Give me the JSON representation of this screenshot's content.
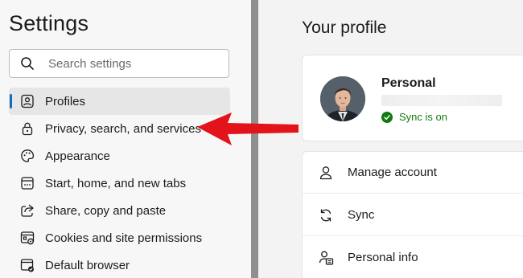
{
  "sidebar": {
    "title": "Settings",
    "search": {
      "placeholder": "Search settings",
      "icon": "search-icon"
    },
    "items": [
      {
        "label": "Profiles",
        "icon": "profile-icon",
        "active": true
      },
      {
        "label": "Privacy, search, and services",
        "icon": "lock-icon",
        "active": false
      },
      {
        "label": "Appearance",
        "icon": "palette-icon",
        "active": false
      },
      {
        "label": "Start, home, and new tabs",
        "icon": "tabs-icon",
        "active": false
      },
      {
        "label": "Share, copy and paste",
        "icon": "share-icon",
        "active": false
      },
      {
        "label": "Cookies and site permissions",
        "icon": "cookies-icon",
        "active": false
      },
      {
        "label": "Default browser",
        "icon": "default-browser-icon",
        "active": false
      }
    ]
  },
  "main": {
    "heading": "Your profile",
    "profile": {
      "name": "Personal",
      "sync_status": "Sync is on"
    },
    "menu": [
      {
        "label": "Manage account",
        "icon": "person-icon"
      },
      {
        "label": "Sync",
        "icon": "sync-icon"
      },
      {
        "label": "Personal info",
        "icon": "personal-info-icon"
      }
    ]
  },
  "colors": {
    "accent": "#0f6cbd",
    "sync_green": "#107c10",
    "annotation_arrow": "#e3131a",
    "divider": "#8f8f8f"
  }
}
